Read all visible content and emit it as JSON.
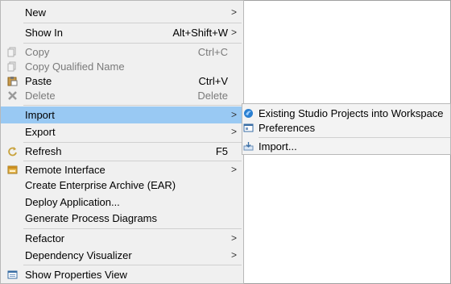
{
  "context_menu": {
    "new_label": "New",
    "show_in_label": "Show In",
    "show_in_shortcut": "Alt+Shift+W",
    "copy_label": "Copy",
    "copy_shortcut": "Ctrl+C",
    "copy_qualified_label": "Copy Qualified Name",
    "paste_label": "Paste",
    "paste_shortcut": "Ctrl+V",
    "delete_label": "Delete",
    "delete_shortcut": "Delete",
    "import_label": "Import",
    "export_label": "Export",
    "refresh_label": "Refresh",
    "refresh_shortcut": "F5",
    "remote_interface_label": "Remote Interface",
    "create_ear_label": "Create Enterprise Archive (EAR)",
    "deploy_label": "Deploy Application...",
    "generate_diagrams_label": "Generate Process Diagrams",
    "refactor_label": "Refactor",
    "dependency_label": "Dependency Visualizer",
    "show_properties_label": "Show Properties View",
    "submenu_arrow": ">"
  },
  "import_submenu": {
    "existing_projects_label": "Existing Studio Projects into Workspace",
    "preferences_label": "Preferences",
    "import_dots_label": "Import..."
  },
  "colors": {
    "highlight": "#99c9f3",
    "menu_bg": "#f0f0f0",
    "disabled_text": "#7a7a7a"
  },
  "icons": [
    "copy-icon",
    "copy-qualified-icon",
    "paste-icon",
    "delete-icon",
    "refresh-icon",
    "remote-interface-icon",
    "show-properties-icon",
    "studio-projects-icon",
    "preferences-icon",
    "import-icon"
  ]
}
